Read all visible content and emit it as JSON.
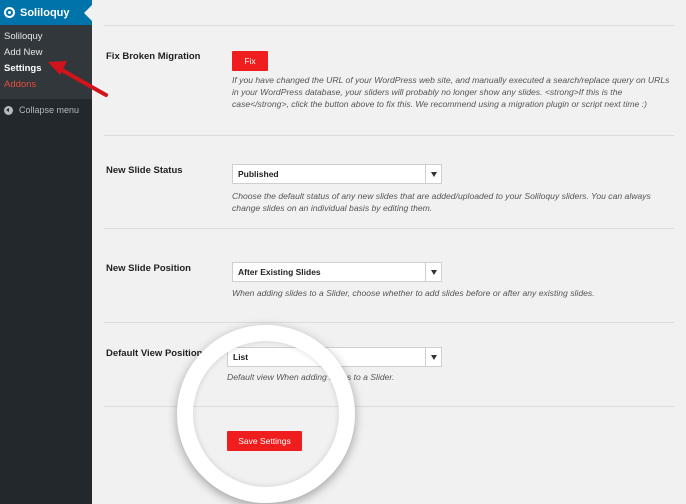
{
  "sidebar": {
    "menu_title": "Soliloquy",
    "items": [
      {
        "label": "Soliloquy"
      },
      {
        "label": "Add New"
      },
      {
        "label": "Settings"
      },
      {
        "label": "Addons"
      }
    ],
    "collapse_label": "Collapse menu"
  },
  "settings": {
    "fix_migration": {
      "label": "Fix Broken Migration",
      "button": "Fix",
      "description": "If you have changed the URL of your WordPress web site, and manually executed a search/replace query on URLs in your WordPress database, your sliders will probably no longer show any slides. <strong>If this is the case</strong>, click the button above to fix this. We recommend using a migration plugin or script next time :)"
    },
    "new_slide_status": {
      "label": "New Slide Status",
      "value": "Published",
      "description": "Choose the default status of any new slides that are added/uploaded to your Soliloquy sliders. You can always change slides on an individual basis by editing them."
    },
    "new_slide_position": {
      "label": "New Slide Position",
      "value": "After Existing Slides",
      "description": "When adding slides to a Slider, choose whether to add slides before or after any existing slides."
    },
    "default_view_position": {
      "label": "Default View Position",
      "value": "List",
      "description": "Default view When adding slides to a Slider."
    },
    "save_button": "Save Settings"
  },
  "colors": {
    "accent_red": "#ef1d1d",
    "sidebar_bg": "#23282d",
    "active_menu": "#0073aa"
  }
}
